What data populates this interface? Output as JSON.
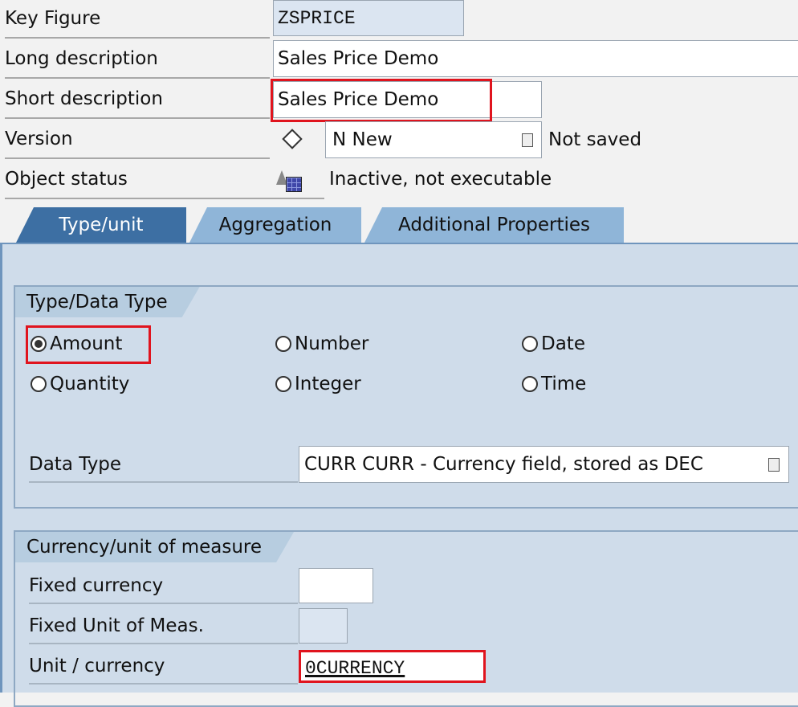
{
  "header": {
    "key_figure": {
      "label": "Key Figure",
      "value": "ZSPRICE"
    },
    "long_description": {
      "label": "Long description",
      "value": "Sales Price Demo"
    },
    "short_description": {
      "label": "Short description",
      "value": "Sales Price Demo"
    },
    "version": {
      "label": "Version",
      "value": "N New",
      "status": "Not saved"
    },
    "object_status": {
      "label": "Object status",
      "value": "Inactive, not executable"
    }
  },
  "tabs": [
    {
      "label": "Type/unit",
      "active": true
    },
    {
      "label": "Aggregation",
      "active": false
    },
    {
      "label": "Additional Properties",
      "active": false
    }
  ],
  "type_group": {
    "title": "Type/Data Type",
    "radios": [
      {
        "label": "Amount",
        "selected": true
      },
      {
        "label": "Number",
        "selected": false
      },
      {
        "label": "Date",
        "selected": false
      },
      {
        "label": "Quantity",
        "selected": false
      },
      {
        "label": "Integer",
        "selected": false
      },
      {
        "label": "Time",
        "selected": false
      }
    ],
    "data_type": {
      "label": "Data Type",
      "value": "CURR CURR - Currency field, stored as DEC"
    }
  },
  "currency_group": {
    "title": "Currency/unit of measure",
    "fixed_currency": {
      "label": "Fixed currency",
      "value": ""
    },
    "fixed_unit": {
      "label": "Fixed Unit of Meas.",
      "value": ""
    },
    "unit_currency": {
      "label": "Unit / currency",
      "value": "0CURRENCY"
    }
  },
  "colors": {
    "highlight": "#e0141e",
    "tab_active": "#3d6fa3",
    "tab_inactive": "#8fb5d8",
    "panel": "#cfdcea"
  }
}
